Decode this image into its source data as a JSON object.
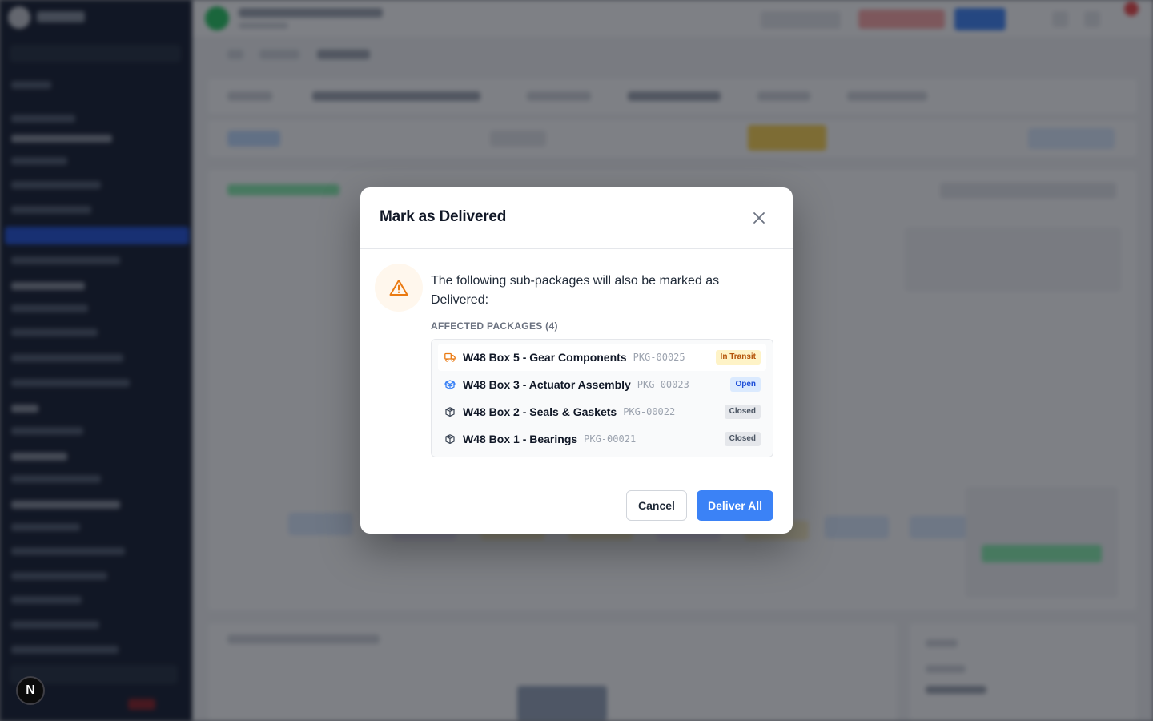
{
  "modal": {
    "title": "Mark as Delivered",
    "message": "The following sub-packages will also be marked as Delivered:",
    "affected_label": "AFFECTED PACKAGES (4)",
    "packages": [
      {
        "icon": "truck-icon",
        "name": "W48 Box 5 - Gear Components",
        "id": "PKG-00025",
        "status": "In Transit",
        "status_color": "#b45309"
      },
      {
        "icon": "open-box-icon",
        "name": "W48 Box 3 - Actuator Assembly",
        "id": "PKG-00023",
        "status": "Open",
        "status_color": "#1d4ed8"
      },
      {
        "icon": "box-icon",
        "name": "W48 Box 2 - Seals & Gaskets",
        "id": "PKG-00022",
        "status": "Closed",
        "status_color": "#4b5563"
      },
      {
        "icon": "box-icon",
        "name": "W48 Box 1 - Bearings",
        "id": "PKG-00021",
        "status": "Closed",
        "status_color": "#4b5563"
      }
    ],
    "cancel_label": "Cancel",
    "confirm_label": "Deliver All"
  },
  "colors": {
    "accent": "#3b82f6",
    "warning": "#ea7a12",
    "overlay": "rgba(20,24,33,0.55)"
  },
  "floating": {
    "label": "N"
  }
}
